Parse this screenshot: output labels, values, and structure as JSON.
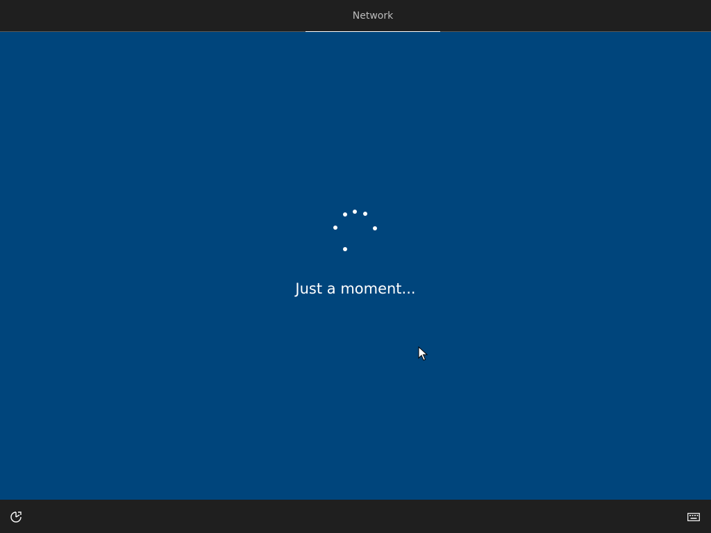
{
  "header": {
    "tabs": [
      {
        "label": "Network",
        "active": true
      }
    ]
  },
  "main": {
    "status_text": "Just a moment...",
    "spinner_icon": "loading-spinner-icon"
  },
  "footer": {
    "left_icon": "ease-of-access-icon",
    "right_icon": "keyboard-icon"
  },
  "colors": {
    "background": "#00457c",
    "bars": "#1f1f1f",
    "text": "#ffffff",
    "tab_text": "#bdbdbd"
  }
}
